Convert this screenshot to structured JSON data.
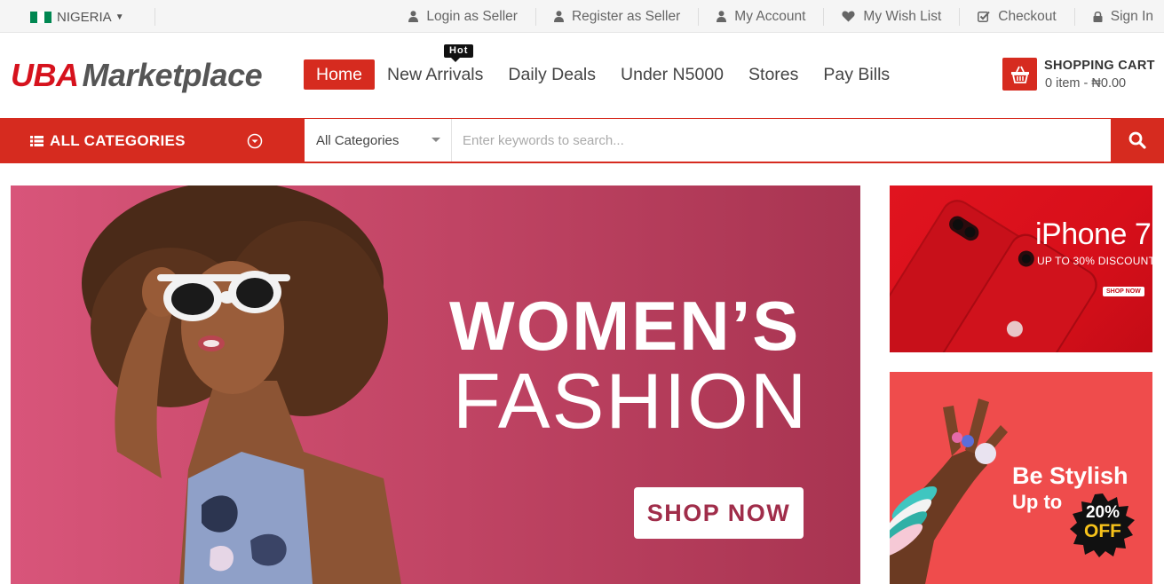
{
  "topbar": {
    "country": "NIGERIA",
    "flag_colors": [
      "#008751",
      "#ffffff",
      "#008751"
    ],
    "links": [
      {
        "label": "Login as Seller",
        "icon": "user-icon"
      },
      {
        "label": "Register as Seller",
        "icon": "user-icon"
      },
      {
        "label": "My Account",
        "icon": "user-icon"
      },
      {
        "label": "My Wish List",
        "icon": "heart-icon"
      },
      {
        "label": "Checkout",
        "icon": "check-square-icon"
      },
      {
        "label": "Sign In",
        "icon": "lock-icon"
      }
    ]
  },
  "header": {
    "logo": {
      "part1": "UBA",
      "part2": "Marketplace"
    },
    "nav": [
      {
        "label": "Home",
        "active": true
      },
      {
        "label": "New Arrivals",
        "badge": "Hot"
      },
      {
        "label": "Daily Deals"
      },
      {
        "label": "Under N5000"
      },
      {
        "label": "Stores"
      },
      {
        "label": "Pay Bills"
      }
    ],
    "cart": {
      "title": "SHOPPING CART",
      "count": "0 item",
      "separator": "-",
      "total": "₦0.00",
      "icon": "basket-icon"
    }
  },
  "catbar": {
    "all_categories": "ALL CATEGORIES",
    "category_select": "All Categories",
    "search_placeholder": "Enter keywords to search...",
    "accent": "#d62b1f"
  },
  "banner": {
    "line1": "WOMEN’S",
    "line2": "FASHION",
    "button": "SHOP NOW"
  },
  "side1": {
    "title": "iPhone 7",
    "subtitle": "UP TO 30% DISCOUNT",
    "button": "SHOP NOW"
  },
  "side2": {
    "title": "Be Stylish",
    "subtitle": "Up to",
    "badge_line1": "20%",
    "badge_line2": "OFF"
  }
}
